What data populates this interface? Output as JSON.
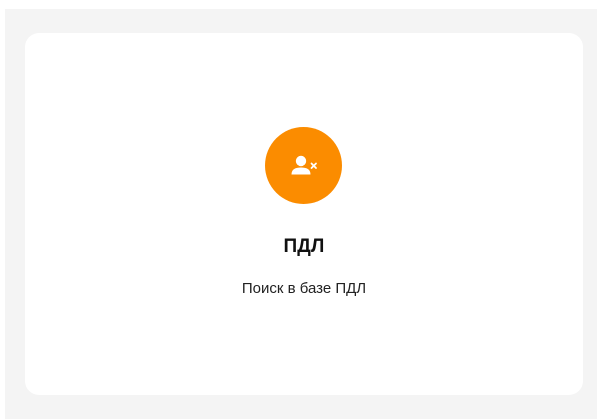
{
  "card": {
    "title": "ПДЛ",
    "subtitle": "Поиск в базе ПДЛ",
    "icon": "user-remove-icon"
  },
  "colors": {
    "accent": "#fb8c00",
    "card_background": "#ffffff",
    "page_background": "#f4f4f4",
    "title": "#111111",
    "subtitle": "#222222"
  }
}
